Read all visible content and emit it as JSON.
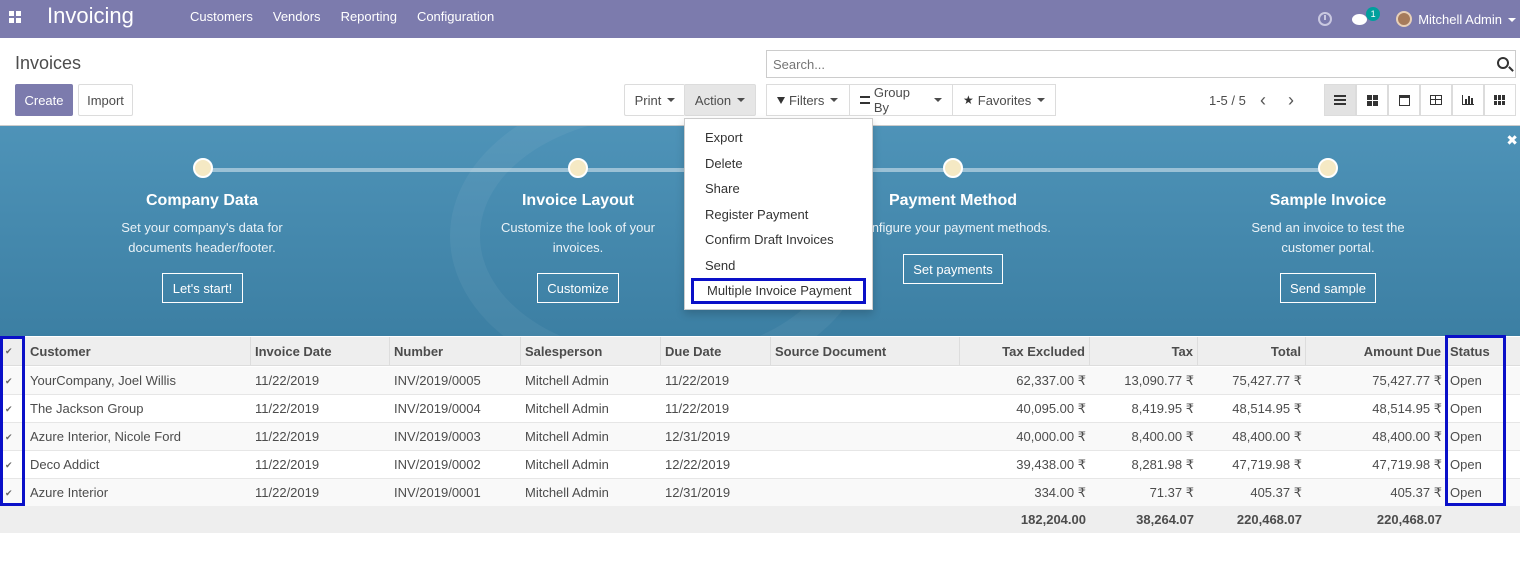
{
  "navbar": {
    "app_title": "Invoicing",
    "menu": [
      "Customers",
      "Vendors",
      "Reporting",
      "Configuration"
    ],
    "chat_count": "1",
    "user_name": "Mitchell Admin"
  },
  "control_panel": {
    "breadcrumb": "Invoices",
    "create_label": "Create",
    "import_label": "Import",
    "print_label": "Print",
    "action_label": "Action",
    "search_placeholder": "Search...",
    "filters_label": "Filters",
    "groupby_label": "Group By",
    "favorites_label": "Favorites",
    "pager": "1-5 / 5"
  },
  "action_menu": [
    "Export",
    "Delete",
    "Share",
    "Register Payment",
    "Confirm Draft Invoices",
    "Send",
    "Multiple Invoice Payment"
  ],
  "banner": {
    "steps": [
      {
        "title": "Company Data",
        "desc": "Set your company's data for documents header/footer.",
        "button": "Let's start!"
      },
      {
        "title": "Invoice Layout",
        "desc": "Customize the look of your invoices.",
        "button": "Customize"
      },
      {
        "title": "Payment Method",
        "desc": "Configure your payment methods.",
        "button": "Set payments"
      },
      {
        "title": "Sample Invoice",
        "desc": "Send an invoice to test the customer portal.",
        "button": "Send sample"
      }
    ]
  },
  "table": {
    "columns": [
      "Customer",
      "Invoice Date",
      "Number",
      "Salesperson",
      "Due Date",
      "Source Document",
      "Tax Excluded",
      "Tax",
      "Total",
      "Amount Due",
      "Status"
    ],
    "rows": [
      [
        "YourCompany, Joel Willis",
        "11/22/2019",
        "INV/2019/0005",
        "Mitchell Admin",
        "11/22/2019",
        "",
        "62,337.00 ₹",
        "13,090.77 ₹",
        "75,427.77 ₹",
        "75,427.77 ₹",
        "Open"
      ],
      [
        "The Jackson Group",
        "11/22/2019",
        "INV/2019/0004",
        "Mitchell Admin",
        "11/22/2019",
        "",
        "40,095.00 ₹",
        "8,419.95 ₹",
        "48,514.95 ₹",
        "48,514.95 ₹",
        "Open"
      ],
      [
        "Azure Interior, Nicole Ford",
        "11/22/2019",
        "INV/2019/0003",
        "Mitchell Admin",
        "12/31/2019",
        "",
        "40,000.00 ₹",
        "8,400.00 ₹",
        "48,400.00 ₹",
        "48,400.00 ₹",
        "Open"
      ],
      [
        "Deco Addict",
        "11/22/2019",
        "INV/2019/0002",
        "Mitchell Admin",
        "12/22/2019",
        "",
        "39,438.00 ₹",
        "8,281.98 ₹",
        "47,719.98 ₹",
        "47,719.98 ₹",
        "Open"
      ],
      [
        "Azure Interior",
        "11/22/2019",
        "INV/2019/0001",
        "Mitchell Admin",
        "12/31/2019",
        "",
        "334.00 ₹",
        "71.37 ₹",
        "405.37 ₹",
        "405.37 ₹",
        "Open"
      ]
    ],
    "totals": {
      "tax_excluded": "182,204.00",
      "tax": "38,264.07",
      "total": "220,468.07",
      "amount_due": "220,468.07"
    }
  },
  "colors": {
    "navbar": "#7c7bad",
    "highlight": "#0a10c8",
    "banner": "#4e93b8"
  }
}
